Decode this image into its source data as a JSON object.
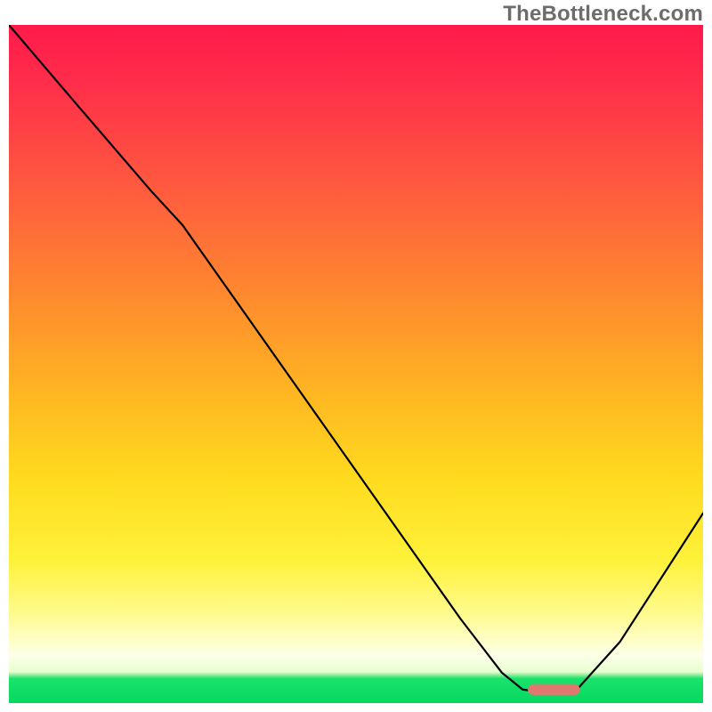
{
  "watermark": "TheBottleneck.com",
  "chart_data": {
    "type": "line",
    "title": "",
    "xlabel": "",
    "ylabel": "",
    "x_range": [
      0,
      100
    ],
    "y_range": [
      0,
      100
    ],
    "gradient_stops": [
      {
        "pos": 0,
        "color": "#ff1a4b"
      },
      {
        "pos": 24,
        "color": "#ff5a3f"
      },
      {
        "pos": 54,
        "color": "#ffb522"
      },
      {
        "pos": 79,
        "color": "#fff23a"
      },
      {
        "pos": 93,
        "color": "#fdffe8"
      },
      {
        "pos": 96,
        "color": "#19e36b"
      },
      {
        "pos": 100,
        "color": "#06d85f"
      }
    ],
    "series": [
      {
        "name": "bottleneck-curve",
        "points": [
          {
            "x": 0.0,
            "y": 100.0
          },
          {
            "x": 10.0,
            "y": 88.0
          },
          {
            "x": 20.5,
            "y": 75.5
          },
          {
            "x": 25.0,
            "y": 70.5
          },
          {
            "x": 35.0,
            "y": 56.0
          },
          {
            "x": 45.0,
            "y": 41.5
          },
          {
            "x": 55.0,
            "y": 27.0
          },
          {
            "x": 65.0,
            "y": 12.5
          },
          {
            "x": 71.0,
            "y": 4.5
          },
          {
            "x": 74.0,
            "y": 2.0
          },
          {
            "x": 77.0,
            "y": 1.6
          },
          {
            "x": 82.0,
            "y": 2.2
          },
          {
            "x": 88.0,
            "y": 9.0
          },
          {
            "x": 94.0,
            "y": 18.5
          },
          {
            "x": 100.0,
            "y": 28.0
          }
        ]
      }
    ],
    "marker": {
      "x_center": 78.5,
      "y_center": 2.0,
      "width": 7.5,
      "height": 1.6,
      "color": "#e1786f"
    }
  }
}
